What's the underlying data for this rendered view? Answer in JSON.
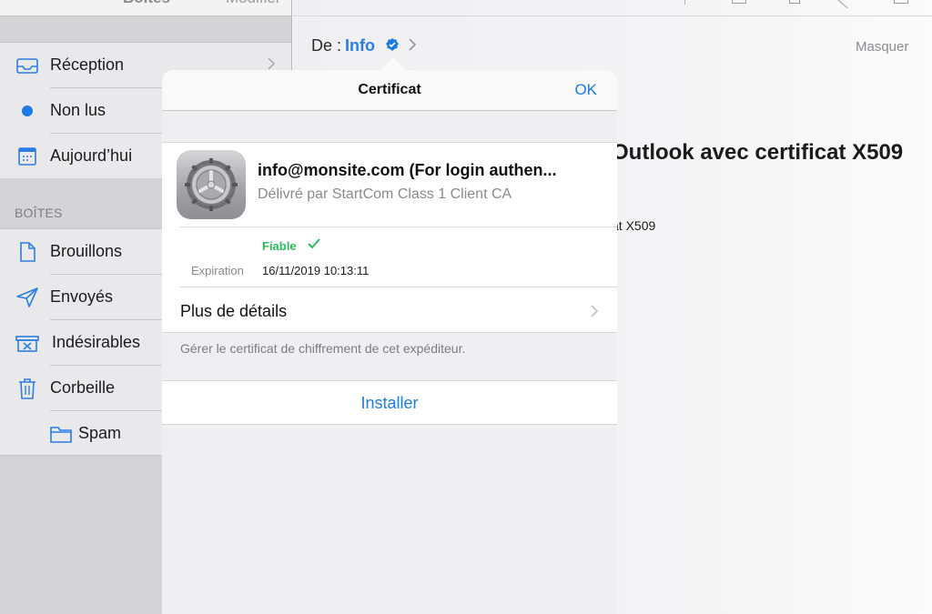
{
  "sidebar": {
    "top_title": "Boîtes",
    "top_edit": "Modifier",
    "mailboxes": [
      {
        "label": "Réception",
        "icon": "inbox-icon"
      },
      {
        "label": "Non lus",
        "icon": "unread-dot-icon"
      },
      {
        "label": "Aujourd’hui",
        "icon": "calendar-icon"
      }
    ],
    "section_header": "BOÎTES",
    "folders": [
      {
        "label": "Brouillons",
        "icon": "document-icon"
      },
      {
        "label": "Envoyés",
        "icon": "paper-plane-icon"
      },
      {
        "label": "Indésirables",
        "icon": "junk-bin-icon"
      },
      {
        "label": "Corbeille",
        "icon": "trash-icon"
      },
      {
        "label": "Spam",
        "icon": "folder-icon"
      }
    ]
  },
  "message": {
    "from_label": "De :",
    "from_name": "Info",
    "hide_label": "Masquer",
    "subject_partial": "Outlook avec certificat X509",
    "body_partial": "at X509"
  },
  "popover": {
    "title": "Certificat",
    "ok_label": "OK",
    "cert": {
      "name": "info@monsite.com (For login authen...",
      "issuer": "Délivré par StartCom Class 1 Client CA",
      "trust_status": "Fiable",
      "expiration_label": "Expiration",
      "expiration_value": "16/11/2019 10:13:11"
    },
    "details_label": "Plus de détails",
    "footnote": "Gérer le certificat de chiffrement de cet expéditeur.",
    "install_label": "Installer"
  },
  "colors": {
    "accent_blue": "#1a7ce4",
    "trust_green": "#2ebd59"
  }
}
